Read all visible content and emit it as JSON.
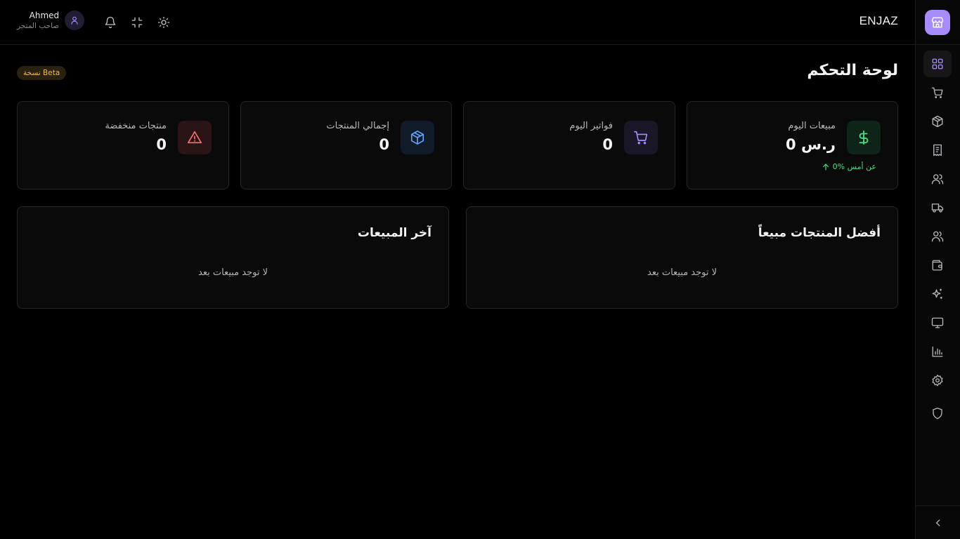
{
  "app": {
    "brand": "ENJAZ"
  },
  "topbar": {
    "user_name": "Ahmed",
    "user_role": "صاحب المتجر",
    "icons": [
      "theme-toggle-icon",
      "minimize-icon",
      "bell-icon",
      "user-icon"
    ]
  },
  "sidebar": {
    "logo_icon": "store-icon",
    "items": [
      {
        "icon": "dashboard-grid-icon",
        "active": true
      },
      {
        "icon": "cart-icon",
        "active": false
      },
      {
        "icon": "box-icon",
        "active": false
      },
      {
        "icon": "receipt-icon",
        "active": false
      },
      {
        "icon": "users-icon",
        "active": false
      },
      {
        "icon": "truck-icon",
        "active": false
      },
      {
        "icon": "team-icon",
        "active": false
      },
      {
        "icon": "wallet-icon",
        "active": false
      },
      {
        "icon": "sparkles-icon",
        "active": false
      },
      {
        "icon": "monitor-icon",
        "active": false
      },
      {
        "icon": "bar-chart-icon",
        "active": false
      },
      {
        "icon": "settings-icon",
        "active": false
      },
      {
        "icon": "shield-icon",
        "active": false
      }
    ],
    "collapse_icon": "chevron-left-icon"
  },
  "main": {
    "title": "لوحة التحكم",
    "badge": "نسخة Beta",
    "stats": [
      {
        "label": "مبيعات اليوم",
        "value": "0 ر.س",
        "trend": "0% عن أمس",
        "icon": "dollar-icon",
        "color": "#4ade80"
      },
      {
        "label": "فواتير اليوم",
        "value": "0",
        "icon": "cart-icon",
        "color": "#a78bfa"
      },
      {
        "label": "إجمالي المنتجات",
        "value": "0",
        "icon": "box-icon",
        "color": "#60a5fa"
      },
      {
        "label": "منتجات منخفضة",
        "value": "0",
        "icon": "alert-triangle-icon",
        "color": "#f87171"
      }
    ],
    "panels": [
      {
        "title": "أفضل المنتجات مبيعاً",
        "empty": "لا توجد مبيعات بعد"
      },
      {
        "title": "آخر المبيعات",
        "empty": "لا توجد مبيعات بعد"
      }
    ]
  }
}
